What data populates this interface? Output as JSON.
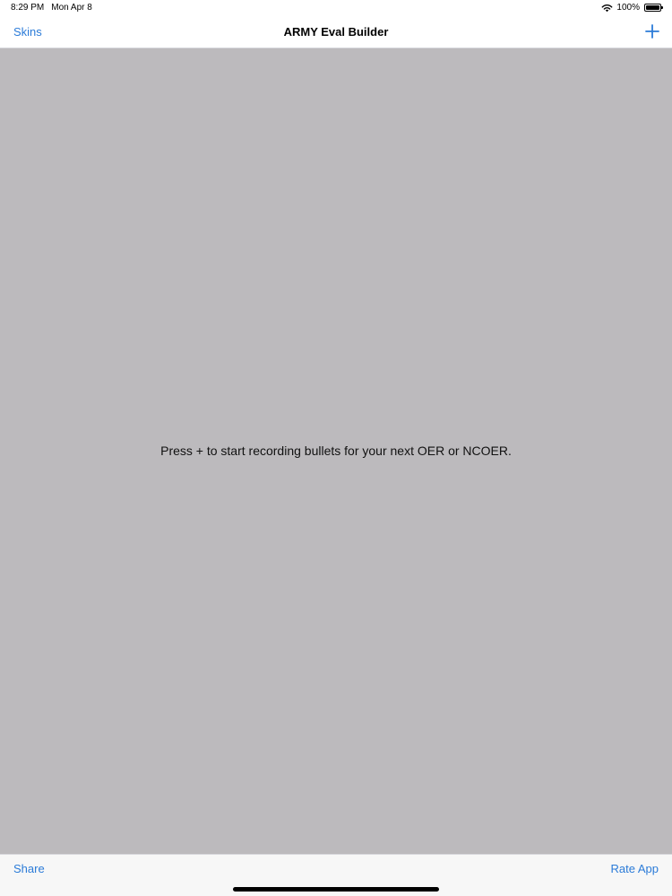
{
  "status_bar": {
    "time": "8:29 PM",
    "date": "Mon Apr 8",
    "battery_text": "100%",
    "battery_level": 1.0,
    "wifi_icon": "wifi-icon",
    "battery_icon": "battery-icon"
  },
  "nav": {
    "left_label": "Skins",
    "title": "ARMY Eval Builder",
    "add_icon": "plus-icon"
  },
  "main": {
    "empty_message": "Press + to start recording bullets for your next OER or NCOER."
  },
  "toolbar": {
    "share_label": "Share",
    "rate_label": "Rate App"
  },
  "colors": {
    "accent": "#2b7bd8",
    "content_background": "#bcbabd",
    "bar_background": "#ffffff",
    "toolbar_background": "#f7f7f7"
  }
}
